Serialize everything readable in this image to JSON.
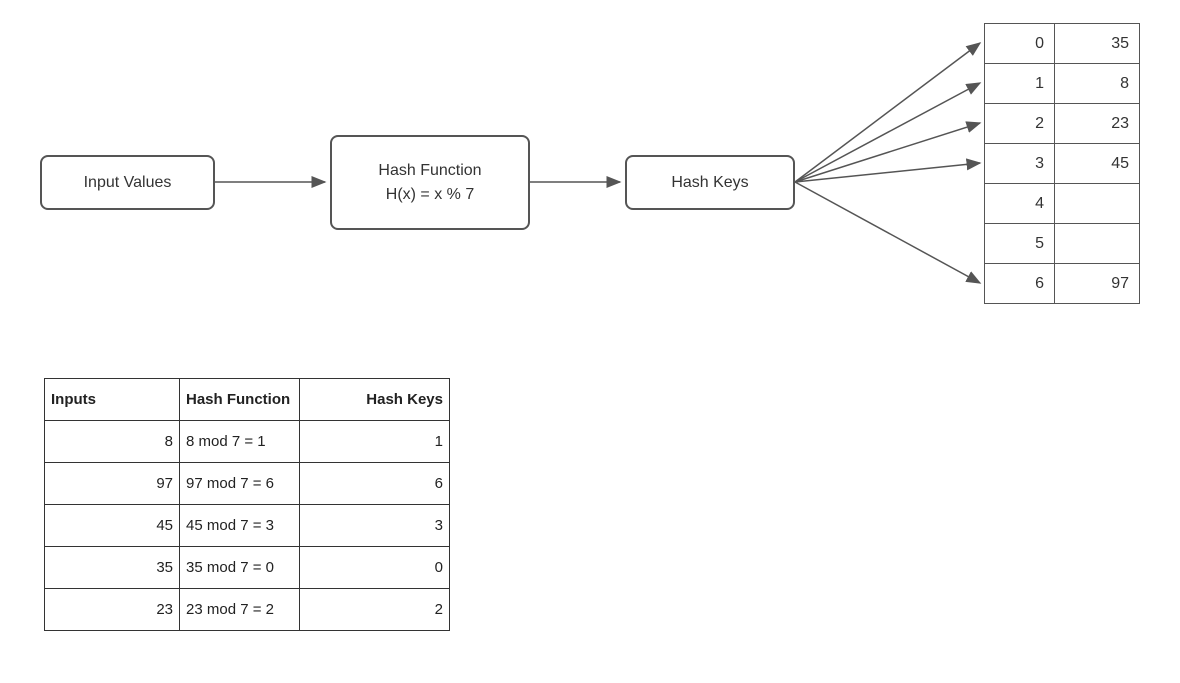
{
  "flow": {
    "input_label": "Input Values",
    "hashfn_line1": "Hash Function",
    "hashfn_line2": "H(x) = x % 7",
    "hashkeys_label": "Hash Keys"
  },
  "hash_table": {
    "rows": [
      {
        "index": "0",
        "value": "35"
      },
      {
        "index": "1",
        "value": "8"
      },
      {
        "index": "2",
        "value": "23"
      },
      {
        "index": "3",
        "value": "45"
      },
      {
        "index": "4",
        "value": ""
      },
      {
        "index": "5",
        "value": ""
      },
      {
        "index": "6",
        "value": "97"
      }
    ]
  },
  "calc_table": {
    "headers": [
      "Inputs",
      "Hash Function",
      "Hash Keys"
    ],
    "rows": [
      {
        "input": "8",
        "fn": "8 mod 7 = 1",
        "key": "1"
      },
      {
        "input": "97",
        "fn": "97 mod 7 = 6",
        "key": "6"
      },
      {
        "input": "45",
        "fn": "45 mod 7 = 3",
        "key": "3"
      },
      {
        "input": "35",
        "fn": "35 mod 7 = 0",
        "key": "0"
      },
      {
        "input": "23",
        "fn": "23 mod 7 = 2",
        "key": "2"
      }
    ]
  }
}
